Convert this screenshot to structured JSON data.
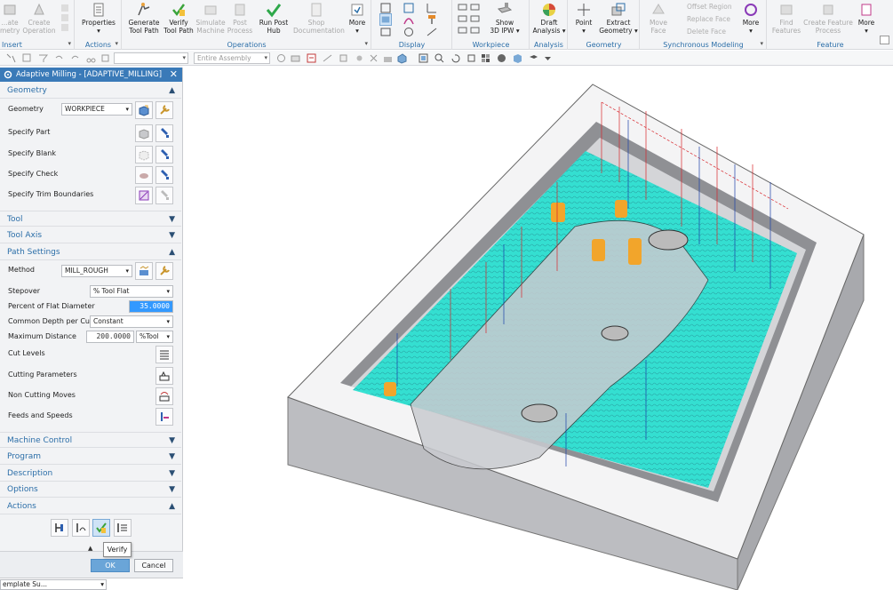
{
  "ribbon": {
    "groups": {
      "insert": "Insert",
      "actions": "Actions",
      "operations": "Operations",
      "display": "Display",
      "workpiece": "Workpiece",
      "analysis": "Analysis",
      "geometry": "Geometry",
      "synchronous": "Synchronous Modeling",
      "feature": "Feature"
    },
    "buttons": {
      "create_geometry": "...ate\nmetry",
      "create_operation": "Create\nOperation",
      "properties": "Properties",
      "generate_tool_path": "Generate\nTool Path",
      "verify_tool_path": "Verify\nTool Path",
      "simulate_machine": "Simulate\nMachine",
      "post_process": "Post\nProcess",
      "run_post_hub": "Run Post\nHub",
      "shop_documentation": "Shop\nDocumentation",
      "more": "More",
      "show_3d_ipw": "Show\n3D IPW",
      "draft_analysis": "Draft\nAnalysis",
      "point": "Point",
      "extract_geometry": "Extract\nGeometry",
      "move_face": "Move\nFace",
      "offset_region": "Offset Region",
      "replace_face": "Replace Face",
      "delete_face": "Delete Face",
      "find_features": "Find\nFeatures",
      "create_feature_process": "Create Feature\nProcess"
    }
  },
  "toolbar2": {
    "filter_value": "",
    "assembly_scope": "Entire Assembly"
  },
  "dialog": {
    "title": "Adaptive Milling - [ADAPTIVE_MILLING]",
    "sections": {
      "geometry": "Geometry",
      "tool": "Tool",
      "tool_axis": "Tool Axis",
      "path_settings": "Path Settings",
      "machine_control": "Machine Control",
      "program": "Program",
      "description": "Description",
      "options": "Options",
      "actions": "Actions"
    },
    "geometry": {
      "geometry_label": "Geometry",
      "geometry_value": "WORKPIECE",
      "specify_part": "Specify Part",
      "specify_blank": "Specify Blank",
      "specify_check": "Specify Check",
      "specify_trim": "Specify Trim Boundaries"
    },
    "path": {
      "method_label": "Method",
      "method_value": "MILL_ROUGH",
      "stepover_label": "Stepover",
      "stepover_value": "% Tool Flat",
      "percent_label": "Percent of Flat Diameter",
      "percent_value": "35.0000",
      "depth_label": "Common Depth per Cut",
      "depth_value": "Constant",
      "maxdist_label": "Maximum Distance",
      "maxdist_value": "200.0000",
      "maxdist_unit": "%Tool",
      "cut_levels": "Cut Levels",
      "cutting_params": "Cutting Parameters",
      "non_cutting": "Non Cutting Moves",
      "feeds_speeds": "Feeds and Speeds"
    },
    "ok": "OK",
    "cancel": "Cancel",
    "tooltip": "Verify"
  },
  "statusbar": {
    "template": "emplate Su..."
  },
  "colors": {
    "accent": "#2b6ea8",
    "title_bar": "#3a7ab8",
    "toolpath_cyan": "#26e0d0",
    "part_gray": "#c8c9cc"
  }
}
